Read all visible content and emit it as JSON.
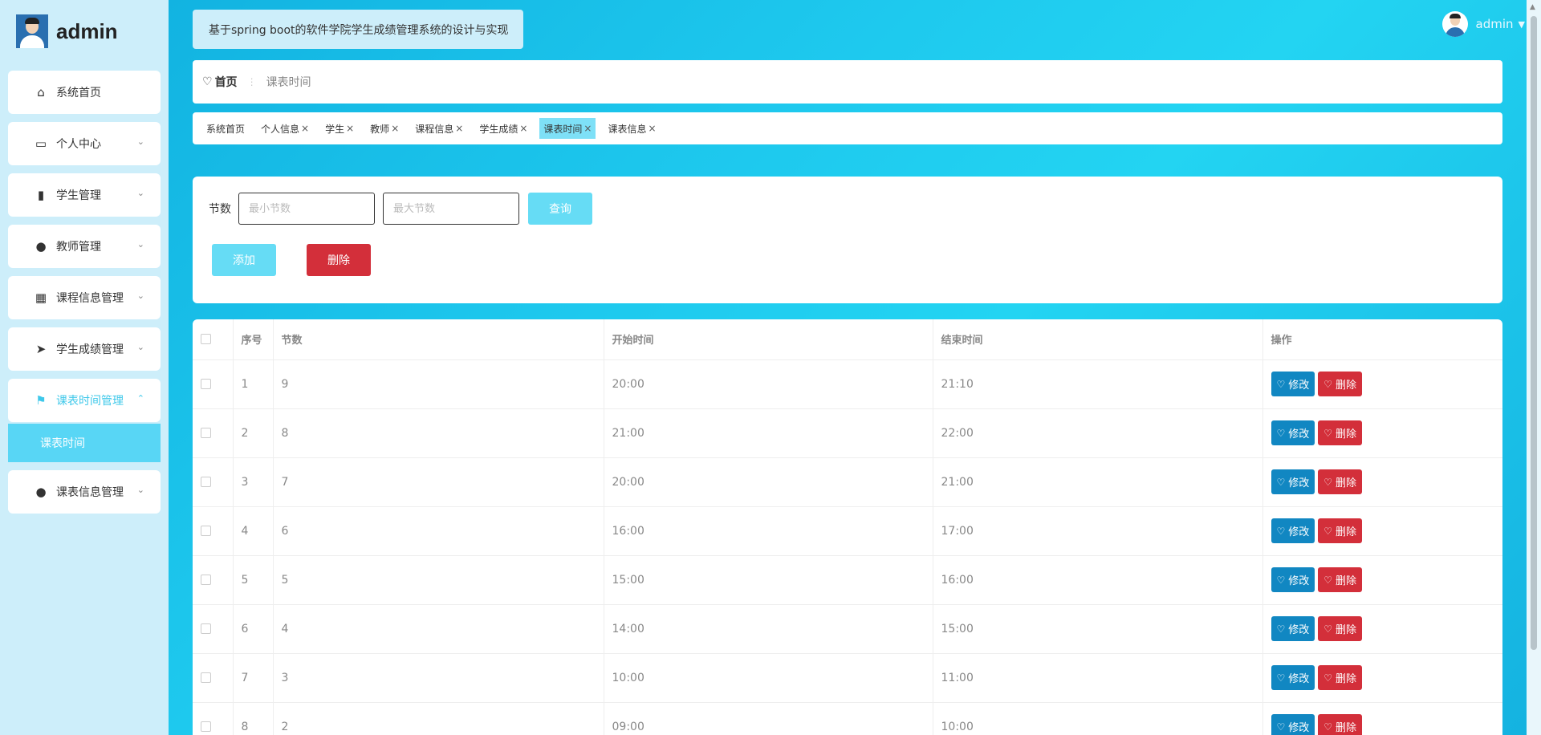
{
  "brand": {
    "name": "admin"
  },
  "sidebar": {
    "items": [
      {
        "label": "系统首页",
        "icon": "home-icon",
        "glyph": "⌂"
      },
      {
        "label": "个人中心",
        "icon": "calendar-icon",
        "glyph": "▭",
        "chevron": "⌄"
      },
      {
        "label": "学生管理",
        "icon": "book-icon",
        "glyph": "▮",
        "chevron": "⌄"
      },
      {
        "label": "教师管理",
        "icon": "user-icon",
        "glyph": "●",
        "chevron": "⌄"
      },
      {
        "label": "课程信息管理",
        "icon": "grid-icon",
        "glyph": "▦",
        "chevron": "⌄"
      },
      {
        "label": "学生成绩管理",
        "icon": "send-icon",
        "glyph": "➤",
        "chevron": "⌄"
      },
      {
        "label": "课表时间管理",
        "icon": "flag-icon",
        "glyph": "⚑",
        "chevron": "⌃"
      },
      {
        "label": "课表信息管理",
        "icon": "bulb-icon",
        "glyph": "●",
        "chevron": "⌄"
      }
    ],
    "sub_active": "课表时间"
  },
  "header": {
    "title": "基于spring boot的软件学院学生成绩管理系统的设计与实现",
    "user": "admin"
  },
  "breadcrumb": {
    "home": "首页",
    "current": "课表时间"
  },
  "tags": [
    {
      "label": "系统首页",
      "closable": false
    },
    {
      "label": "个人信息",
      "closable": true
    },
    {
      "label": "学生",
      "closable": true
    },
    {
      "label": "教师",
      "closable": true
    },
    {
      "label": "课程信息",
      "closable": true
    },
    {
      "label": "学生成绩",
      "closable": true
    },
    {
      "label": "课表时间",
      "closable": true,
      "active": true
    },
    {
      "label": "课表信息",
      "closable": true
    }
  ],
  "search": {
    "label": "节数",
    "min_placeholder": "最小节数",
    "max_placeholder": "最大节数",
    "query_label": "查询",
    "add_label": "添加",
    "delete_label": "删除"
  },
  "table": {
    "headers": [
      "序号",
      "节数",
      "开始时间",
      "结束时间",
      "操作"
    ],
    "edit_label": "修改",
    "delete_label": "删除",
    "rows": [
      {
        "index": "1",
        "section": "9",
        "start": "20:00",
        "end": "21:10"
      },
      {
        "index": "2",
        "section": "8",
        "start": "21:00",
        "end": "22:00"
      },
      {
        "index": "3",
        "section": "7",
        "start": "20:00",
        "end": "21:00"
      },
      {
        "index": "4",
        "section": "6",
        "start": "16:00",
        "end": "17:00"
      },
      {
        "index": "5",
        "section": "5",
        "start": "15:00",
        "end": "16:00"
      },
      {
        "index": "6",
        "section": "4",
        "start": "14:00",
        "end": "15:00"
      },
      {
        "index": "7",
        "section": "3",
        "start": "10:00",
        "end": "11:00"
      },
      {
        "index": "8",
        "section": "2",
        "start": "09:00",
        "end": "10:00"
      }
    ]
  },
  "colors": {
    "accent": "#58d6f5",
    "danger": "#d32f3a",
    "edit": "#1187c2"
  }
}
